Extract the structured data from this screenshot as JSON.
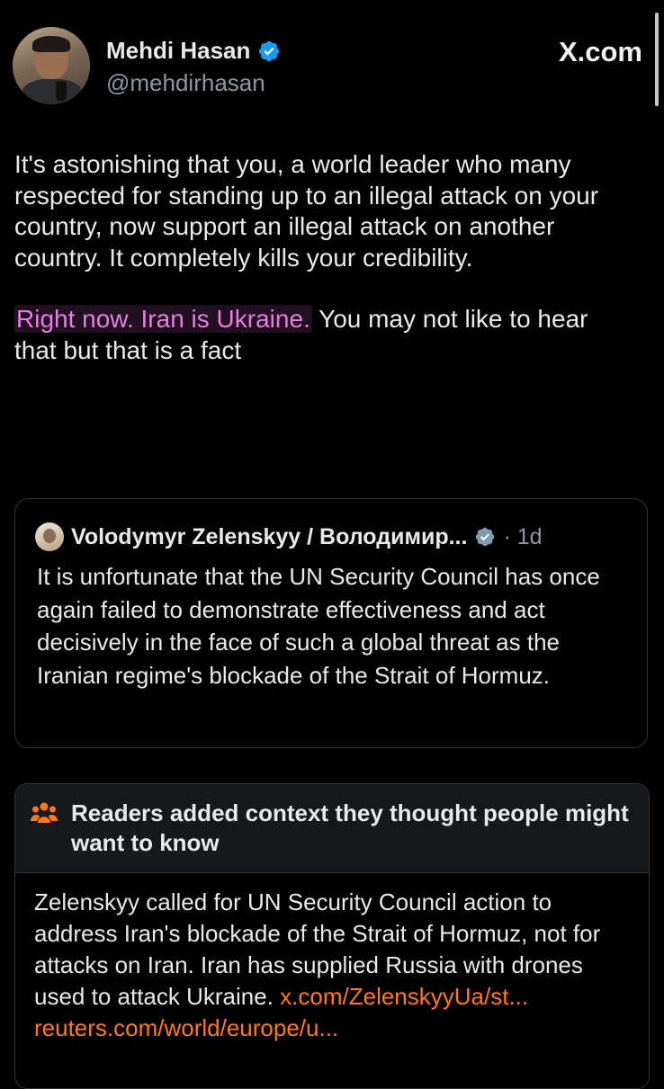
{
  "header": {
    "name": "Mehdi Hasan",
    "handle": "@mehdirhasan",
    "source": "X.com"
  },
  "post": {
    "paragraph_1": "It's astonishing that you, a world leader who many respected for standing up to an illegal attack on your country, now support an illegal attack on another country. It completely kills your credibility.",
    "highlight": "Right now. Iran is Ukraine.",
    "paragraph_2_rest": " You may not like to hear that but that is a fact"
  },
  "quote": {
    "name": "Volodymyr Zelenskyy / Володимир...",
    "time": "· 1d",
    "text": "It is unfortunate that the UN Security Council has once again failed to demonstrate effectiveness and act decisively in the face of such a global threat as the Iranian regime's blockade of the Strait of Hormuz."
  },
  "note": {
    "title": "Readers added context they thought people might want to know",
    "body": "Zelenskyy called for UN Security Council action to address Iran's blockade of the Strait of Hormuz, not for attacks on Iran. Iran has supplied Russia with drones used to attack Ukraine.",
    "link_1": "x.com/ZelenskyyUa/st...",
    "link_2": "reuters.com/world/europe/u..."
  },
  "colors": {
    "background": "#000000",
    "text": "#e7e9ea",
    "muted": "#8b98a5",
    "highlight": "#ea7ae6",
    "verified": "#1d9bf0",
    "link": "#ff7a1a"
  },
  "icons": [
    "verified-icon",
    "community-notes-icon"
  ]
}
